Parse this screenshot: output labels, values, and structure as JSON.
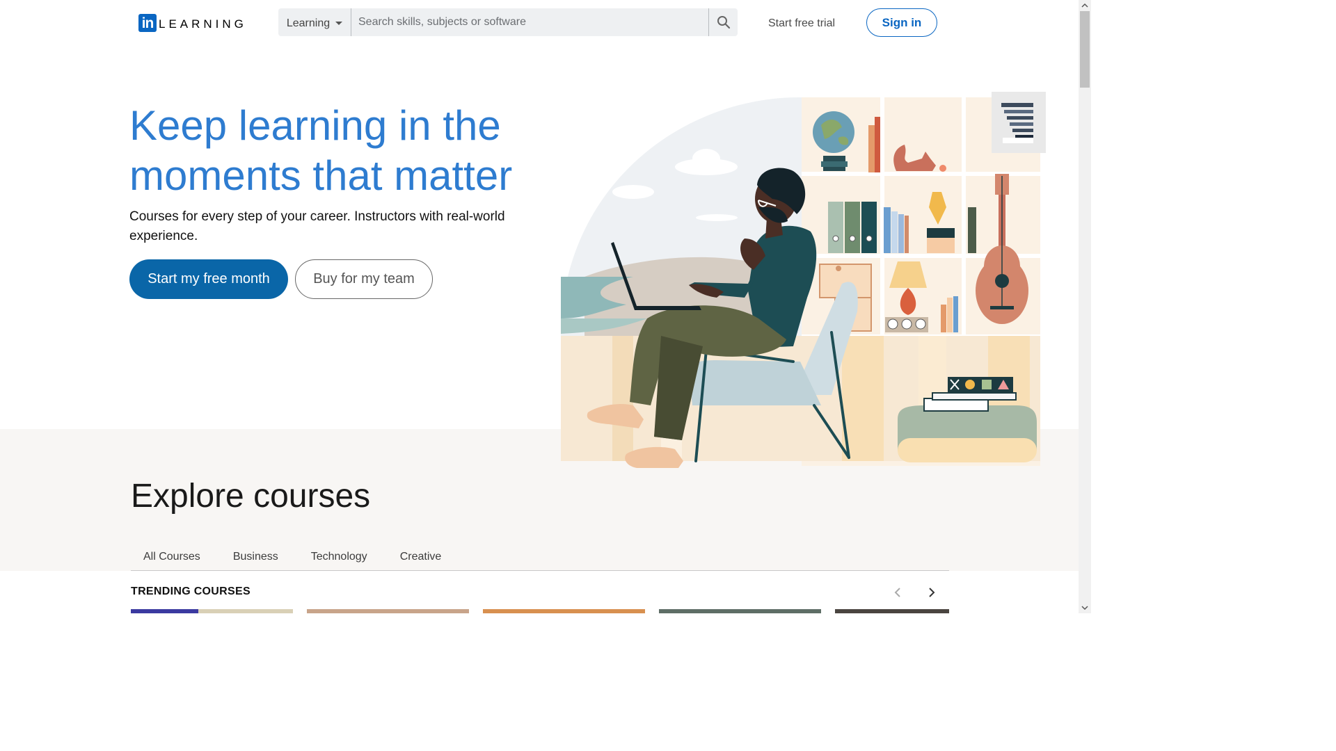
{
  "header": {
    "logo_badge": "in",
    "logo_text": "LEARNING",
    "search_type": "Learning",
    "search_placeholder": "Search skills, subjects or software",
    "trial_link": "Start free trial",
    "signin": "Sign in"
  },
  "hero": {
    "title": "Keep learning in the moments that matter",
    "subtitle": "Courses for every step of your career. Instructors with real-world experience.",
    "primary_button": "Start my free month",
    "secondary_button": "Buy for my team"
  },
  "explore": {
    "title": "Explore courses",
    "tabs": [
      "All Courses",
      "Business",
      "Technology",
      "Creative"
    ],
    "trending_label": "TRENDING COURSES"
  },
  "icons": {
    "search": "search-icon",
    "caret": "chevron-down-icon",
    "prev": "chevron-left-icon",
    "next": "chevron-right-icon"
  },
  "colors": {
    "brand": "#0a66c2",
    "hero_title": "#2e7cd0",
    "primary_button": "#0a66a8",
    "band_background": "#f8f6f4"
  }
}
